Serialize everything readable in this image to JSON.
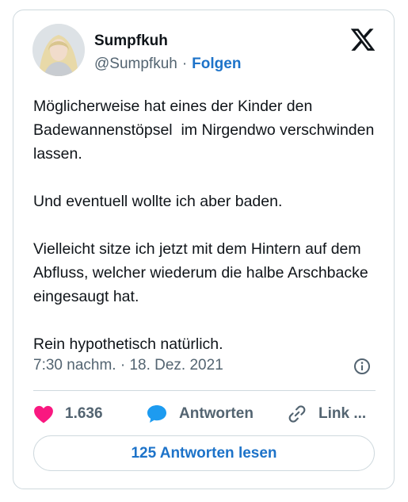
{
  "author": {
    "name": "Sumpfkuh",
    "handle": "@Sumpfkuh",
    "separator": "·",
    "follow_label": "Folgen"
  },
  "tweet": {
    "paragraphs": [
      "Möglicherweise hat eines der Kinder den Badewannenstöpsel  im Nirgendwo verschwinden lassen.",
      "Und eventuell wollte ich aber baden.",
      "Vielleicht sitze ich jetzt mit dem Hintern auf dem Abfluss, welcher wiederum die halbe Arschbacke eingesaugt hat.",
      "Rein hypothetisch natürlich."
    ],
    "timestamp": "7:30 nachm. · 18. Dez. 2021"
  },
  "actions": {
    "likes_count": "1.636",
    "reply_label": "Antworten",
    "copy_link_label": "Link ..."
  },
  "read_replies_label": "125 Antworten lesen",
  "icons": {
    "logo": "x-logo-icon",
    "info": "info-icon",
    "heart": "heart-icon",
    "reply": "speech-bubble-icon",
    "link": "link-icon"
  },
  "colors": {
    "heart": "#f91880",
    "reply_bubble": "#1d9bf0",
    "follow_link": "#1d73c9",
    "secondary_text": "#536471"
  }
}
